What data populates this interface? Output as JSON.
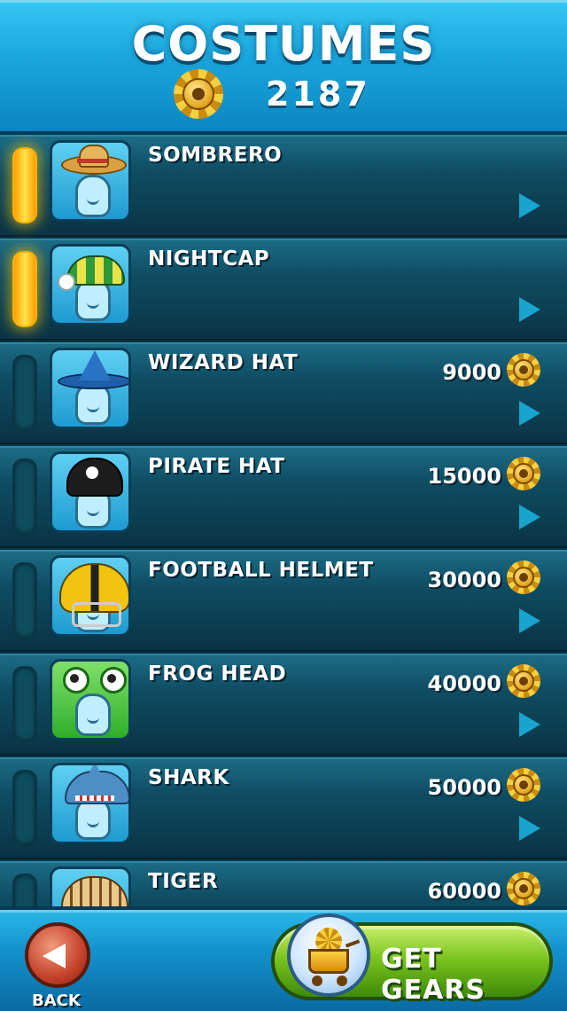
{
  "header": {
    "title": "COSTUMES",
    "gear_count": "2187",
    "currency_icon": "gear-icon"
  },
  "costumes": [
    {
      "name": "SOMBRERO",
      "price": "",
      "owned": true,
      "icon": "sombrero-icon"
    },
    {
      "name": "NIGHTCAP",
      "price": "",
      "owned": true,
      "icon": "nightcap-icon"
    },
    {
      "name": "WIZARD HAT",
      "price": "9000",
      "owned": false,
      "icon": "wizard-hat-icon"
    },
    {
      "name": "PIRATE HAT",
      "price": "15000",
      "owned": false,
      "icon": "pirate-hat-icon"
    },
    {
      "name": "FOOTBALL HELMET",
      "price": "30000",
      "owned": false,
      "icon": "football-helmet-icon"
    },
    {
      "name": "FROG HEAD",
      "price": "40000",
      "owned": false,
      "icon": "frog-head-icon"
    },
    {
      "name": "SHARK",
      "price": "50000",
      "owned": false,
      "icon": "shark-icon"
    },
    {
      "name": "TIGER",
      "price": "60000",
      "owned": false,
      "icon": "tiger-icon"
    }
  ],
  "footer": {
    "back_label": "BACK",
    "get_gears_label": "GET GEARS"
  },
  "colors": {
    "header_blue": "#1aa6dc",
    "row_teal": "#0f4d63",
    "owned_indicator": "#ffd21f",
    "button_green": "#7cc41f",
    "back_red": "#c5412b"
  }
}
